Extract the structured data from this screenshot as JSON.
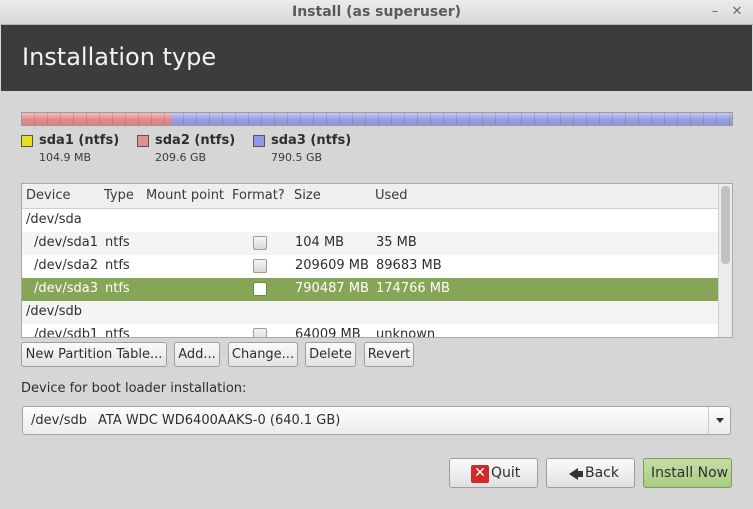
{
  "window": {
    "title": "Install (as superuser)"
  },
  "header": {
    "title": "Installation type"
  },
  "partition_bar": {
    "segments": [
      {
        "name": "sda1",
        "fraction": 0.0001,
        "color": "#e6e020"
      },
      {
        "name": "sda2",
        "fraction": 0.2095,
        "color": "#e58c8c"
      },
      {
        "name": "sda3",
        "fraction": 0.7904,
        "color": "#9aa0e6"
      }
    ]
  },
  "legend": [
    {
      "name": "sda1 (ntfs)",
      "size": "104.9 MB",
      "color": "#e6e020"
    },
    {
      "name": "sda2 (ntfs)",
      "size": "209.6 GB",
      "color": "#e58c8c"
    },
    {
      "name": "sda3 (ntfs)",
      "size": "790.5 GB",
      "color": "#8f98e8"
    }
  ],
  "table": {
    "columns": [
      "Device",
      "Type",
      "Mount point",
      "Format?",
      "Size",
      "Used"
    ],
    "rows": [
      {
        "device": "/dev/sda",
        "type": "",
        "mount": "",
        "format": false,
        "size": "",
        "used": ""
      },
      {
        "device": "/dev/sda1",
        "type": "ntfs",
        "mount": "",
        "format": false,
        "size": "104 MB",
        "used": "35 MB"
      },
      {
        "device": "/dev/sda2",
        "type": "ntfs",
        "mount": "",
        "format": false,
        "size": "209609 MB",
        "used": "89683 MB"
      },
      {
        "device": "/dev/sda3",
        "type": "ntfs",
        "mount": "",
        "format": false,
        "size": "790487 MB",
        "used": "174766 MB",
        "selected": true
      },
      {
        "device": "/dev/sdb",
        "type": "",
        "mount": "",
        "format": false,
        "size": "",
        "used": ""
      },
      {
        "device": "/dev/sdb1",
        "type": "ntfs",
        "mount": "",
        "format": false,
        "size": "64009 MB",
        "used": "unknown"
      }
    ]
  },
  "actions": {
    "new_table": "New Partition Table...",
    "add": "Add...",
    "change": "Change...",
    "delete": "Delete",
    "revert": "Revert"
  },
  "bootloader": {
    "label": "Device for boot loader installation:",
    "device": "/dev/sdb",
    "description": "ATA WDC WD6400AAKS-0 (640.1 GB)"
  },
  "footer": {
    "quit": "Quit",
    "back": "Back",
    "install": "Install Now"
  },
  "colors": {
    "header_bg": "#3c3c3c",
    "selection": "#87a556",
    "install_button": "#b6d493"
  }
}
